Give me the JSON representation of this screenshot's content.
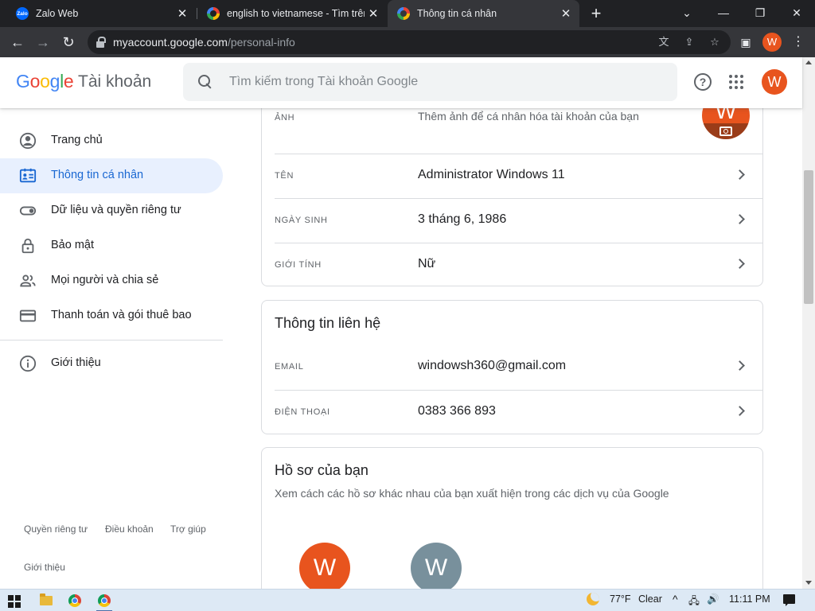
{
  "tabs": [
    {
      "title": "Zalo Web",
      "favicon": "zalo-favicon",
      "fav_text": "Zalo"
    },
    {
      "title": "english to vietnamese - Tìm trên",
      "favicon": "google-favicon"
    },
    {
      "title": "Thông tin cá nhân",
      "favicon": "google-favicon",
      "active": true
    }
  ],
  "window_controls": {
    "tab_search": "⌄",
    "minimize": "—",
    "restore": "❐",
    "close": "✕"
  },
  "toolbar": {
    "url_host": "myaccount.google.com",
    "url_path": "/personal-info",
    "profile_initial": "W"
  },
  "header": {
    "logo_letters": [
      "G",
      "o",
      "o",
      "g",
      "l",
      "e"
    ],
    "logo_colors": [
      "#4285f4",
      "#ea4335",
      "#fbbc05",
      "#4285f4",
      "#34a853",
      "#ea4335"
    ],
    "product": "Tài khoản",
    "search_placeholder": "Tìm kiếm trong Tài khoản Google",
    "avatar_initial": "W",
    "avatar_color": "#e8541e"
  },
  "sidebar": {
    "items": [
      {
        "label": "Trang chủ",
        "icon": "account-circle-icon"
      },
      {
        "label": "Thông tin cá nhân",
        "icon": "id-card-icon",
        "active": true
      },
      {
        "label": "Dữ liệu và quyền riêng tư",
        "icon": "toggle-icon"
      },
      {
        "label": "Bảo mật",
        "icon": "lock-icon"
      },
      {
        "label": "Mọi người và chia sẻ",
        "icon": "people-icon"
      },
      {
        "label": "Thanh toán và gói thuê bao",
        "icon": "credit-card-icon"
      },
      {
        "label": "Giới thiệu",
        "icon": "info-icon"
      }
    ],
    "footer": {
      "privacy": "Quyền riêng tư",
      "terms": "Điều khoản",
      "help": "Trợ giúp",
      "about": "Giới thiệu"
    }
  },
  "basic_info": {
    "photo": {
      "label": "ẢNH",
      "value": "Thêm ảnh để cá nhân hóa tài khoản của bạn",
      "initial": "W"
    },
    "name": {
      "label": "TÊN",
      "value": "Administrator Windows 11"
    },
    "birthday": {
      "label": "NGÀY SINH",
      "value": "3 tháng 6, 1986"
    },
    "gender": {
      "label": "GIỚI TÍNH",
      "value": "Nữ"
    }
  },
  "contact_info": {
    "title": "Thông tin liên hệ",
    "email": {
      "label": "EMAIL",
      "value": "windowsh360@gmail.com"
    },
    "phone": {
      "label": "ĐIỆN THOẠI",
      "value": "0383 366 893"
    }
  },
  "profiles": {
    "title": "Hồ sơ của bạn",
    "description": "Xem cách các hồ sơ khác nhau của bạn xuất hiện trong các dịch vụ của Google",
    "avatars": [
      {
        "initial": "W",
        "color": "#e8541e"
      },
      {
        "initial": "W",
        "color": "#78909c"
      }
    ]
  },
  "taskbar": {
    "weather_temp": "77°F",
    "weather_text": "Clear",
    "time": "11:11 PM",
    "tray_chevron": "^"
  }
}
